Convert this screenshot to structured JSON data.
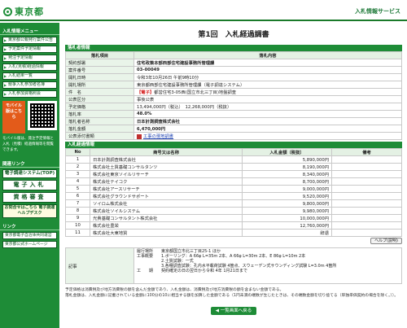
{
  "header": {
    "logo_text": "東京都",
    "service_name": "入札情報サービス"
  },
  "sidebar": {
    "menu_heading": "入札情報メニュー",
    "items": [
      "東京都公報発行案件公告",
      "予定案件予定情報",
      "発注予定情報",
      "入札(見積)経過情報",
      "入札結果一覧",
      "競争入札参加者名簿",
      "入札参加資格照会"
    ],
    "mobile_label": "モバイル版はこちら",
    "mobile_note": "モバイル版は、発注予定情報と入札（見積）経過情報等を閲覧できます。",
    "system_heading": "関連リンク",
    "banners": [
      "電子調達システム(TOP)",
      "電子入札",
      "資格審査",
      "お問合せはこちら 電子調達ヘルプデスク"
    ],
    "links_heading": "リンク",
    "links": [
      "東京都電子自治体共同運営",
      "東京都公式ホームページ"
    ]
  },
  "main": {
    "title": "第1回　入札経過調書",
    "notice_section": "落札者情報",
    "detail_header": {
      "item": "落札項目",
      "content": "落札内容"
    },
    "details": [
      {
        "key": "契約部署",
        "value": "住宅政策本部西部住宅建設事務所管理課",
        "style": "bold"
      },
      {
        "key": "案件番号",
        "value": "03-00049",
        "style": "bold"
      },
      {
        "key": "開札日時",
        "value": "令和3年10月26日 午前9時10分",
        "style": ""
      },
      {
        "key": "開札場所",
        "value": "東京都西部住宅建設事務所管理課（電子調達システム）",
        "style": ""
      },
      {
        "key": "件　名",
        "value": "都営住宅3-05西(国立市北三丁目)地盤調査",
        "style": "red",
        "prefix": "【電子】"
      },
      {
        "key": "公表区分",
        "value": "事後公表",
        "style": ""
      },
      {
        "key": "予定価格",
        "value": "13,494,000円（税込）　12,268,000円（税抜）",
        "style": ""
      },
      {
        "key": "落札率",
        "value": "48.0%",
        "style": "bold"
      },
      {
        "key": "落札者名称",
        "value": "日本計測調査株式会社",
        "style": "bold"
      },
      {
        "key": "落札金額",
        "value": "6,470,000円",
        "style": "bold"
      },
      {
        "key": "公表添付書類",
        "value": "工事の現地調書",
        "style": "link"
      }
    ],
    "bids_section": "入札経過情報",
    "bid_header": {
      "no": "No",
      "name": "商号又は名称",
      "amount": "入札金額（税抜）",
      "remarks": "備考"
    },
    "bids": [
      {
        "no": "1",
        "name": "日本計測調査株式会社",
        "amount": "5,890,000円",
        "remarks": ""
      },
      {
        "no": "2",
        "name": "株式会社土質基礎コンサルタンツ",
        "amount": "8,190,000円",
        "remarks": ""
      },
      {
        "no": "3",
        "name": "株式会社東京ソイルリサーチ",
        "amount": "8,340,000円",
        "remarks": ""
      },
      {
        "no": "4",
        "name": "株式会社テイコク",
        "amount": "8,700,000円",
        "remarks": ""
      },
      {
        "no": "5",
        "name": "株式会社アースリサーチ",
        "amount": "9,000,000円",
        "remarks": ""
      },
      {
        "no": "6",
        "name": "株式会社グラウンドサポート",
        "amount": "9,520,000円",
        "remarks": ""
      },
      {
        "no": "7",
        "name": "ソイロム株式会社",
        "amount": "9,800,000円",
        "remarks": ""
      },
      {
        "no": "8",
        "name": "株式会社ソイルシステム",
        "amount": "9,980,000円",
        "remarks": ""
      },
      {
        "no": "9",
        "name": "光貴基礎コンサルタント株式会社",
        "amount": "10,000,000円",
        "remarks": ""
      },
      {
        "no": "10",
        "name": "株式会社豊栄",
        "amount": "12,760,000円",
        "remarks": ""
      },
      {
        "no": "11",
        "name": "株式会社大東地質",
        "amount": "辞退",
        "remarks": ""
      }
    ],
    "help_button": "ヘルプ(説明)",
    "memo_label": "記事",
    "memo_text": "履行場所　　東京都国立市北三丁目25-1 ほか\n工事概要　　1.ボーリング：A 66φ L=35m 2本、A 66φ L=30m 2本、E 86φ L=10m 2本\n　　　　　　2.土質試験：一式\n　　　　　　3.各種調査試験：孔内水平載荷試験 4箇点、スウェーデン式サウンディング試験 L=3.0m 4箇所\n工　　期　　契約確定の日の翌日から令和 4年 1月21日まで",
    "footnote": "予定価格は消費税及び地方消費税の額を含んだ金額であり、入札金額は、消費税及び地方消費税の額を含まない金額である。\n落札金額は、入札金額に記載されている金額に100分の10に相当する額を加算した金額である（1円未満の端数が生じたときは、その端数金額を切り捨てる（単独単価契約の場合を除く。））。",
    "back_button": "一覧画面へ戻る"
  },
  "colors": {
    "brand_green": "#1e8c37",
    "highlight_red": "#d41a1a"
  }
}
